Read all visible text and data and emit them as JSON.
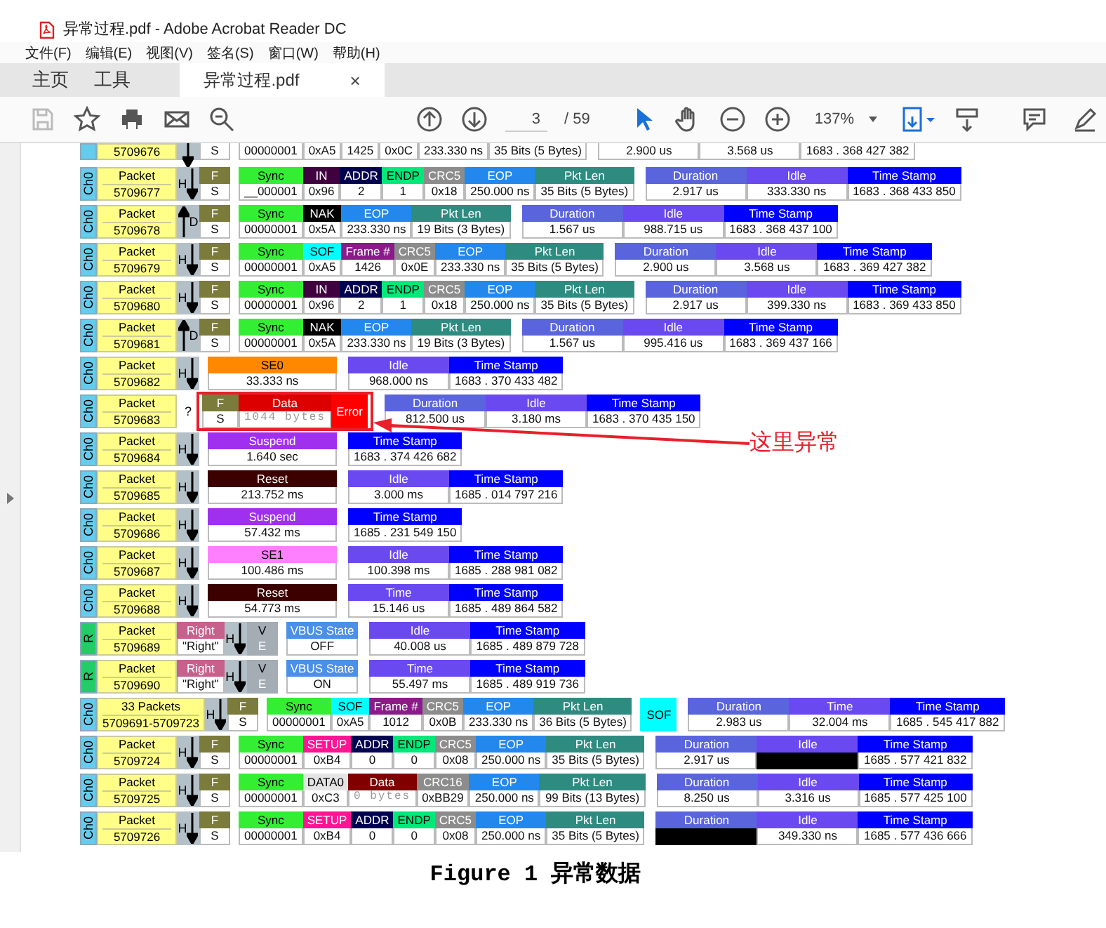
{
  "window": {
    "title": "异常过程.pdf - Adobe Acrobat Reader DC"
  },
  "menu": [
    "文件(F)",
    "编辑(E)",
    "视图(V)",
    "签名(S)",
    "窗口(W)",
    "帮助(H)"
  ],
  "tabs": [
    {
      "label": "主页",
      "selected": false,
      "kind": "nav"
    },
    {
      "label": "工具",
      "selected": false,
      "kind": "nav"
    },
    {
      "label": "异常过程.pdf",
      "selected": true,
      "kind": "document",
      "close": "×"
    }
  ],
  "toolbar": {
    "page": "3",
    "total": "/ 59",
    "zoom": "137%"
  },
  "rows": [
    {
      "kind": "partial",
      "channel": {
        "color": "#66ccee"
      },
      "packet": [
        "5709676"
      ],
      "flagged": false,
      "groups": [
        {
          "kind": "down"
        },
        {
          "kind": "attached",
          "fields": [
            {
              "value": "S"
            }
          ]
        },
        {
          "kind": "fields",
          "fields": [
            {
              "value": "00000001"
            },
            {
              "value": "0xA5"
            },
            {
              "value": "1425"
            },
            {
              "value": "0x0C"
            },
            {
              "value": "233.330 ns"
            },
            {
              "value": "35 Bits (5 Bytes)"
            }
          ]
        },
        {
          "kind": "timing",
          "fields": [
            {
              "value": "2.900 us"
            },
            {
              "value": "3.568 us"
            },
            {
              "value": "1683 . 368 427 382"
            }
          ]
        }
      ]
    },
    {
      "kind": "packet",
      "channel": {
        "label": "Ch0",
        "color": "#66ccee"
      },
      "packet": [
        "Packet",
        "5709677"
      ],
      "flagged": false,
      "groups": [
        {
          "kind": "down",
          "label": "H"
        },
        {
          "kind": "attached",
          "fields": [
            {
              "head": "F",
              "value": "S",
              "color": "#7b7b3b"
            }
          ]
        },
        {
          "kind": "fields",
          "fields": [
            {
              "head": "Sync",
              "value": "__000001",
              "color": "#33ee33"
            },
            {
              "head": "IN",
              "value": "0x96",
              "color": "#400040"
            },
            {
              "head": "ADDR",
              "value": "2",
              "color": "#000050"
            },
            {
              "head": "ENDP",
              "value": "1",
              "color": "#00e87a"
            },
            {
              "head": "CRC5",
              "value": "0x18",
              "color": "#8c8c8c"
            },
            {
              "head": "EOP",
              "value": "250.000 ns",
              "color": "#2288ee"
            },
            {
              "head": "Pkt Len",
              "value": "35 Bits (5 Bytes)",
              "color": "#2e8b80"
            }
          ]
        },
        {
          "kind": "timing",
          "fields": [
            {
              "head": "Duration",
              "value": "2.917 us",
              "color": "#5a64dc"
            },
            {
              "head": "Idle",
              "value": "333.330 ns",
              "color": "#6a4af0"
            },
            {
              "head": "Time Stamp",
              "value": "1683 . 368 433 850",
              "color": "#0000ff"
            }
          ]
        }
      ]
    },
    {
      "kind": "packet",
      "channel": {
        "label": "Ch0",
        "color": "#66ccee"
      },
      "packet": [
        "Packet",
        "5709678"
      ],
      "flagged": false,
      "groups": [
        {
          "kind": "up",
          "label": "D"
        },
        {
          "kind": "attached",
          "fields": [
            {
              "head": "F",
              "value": "S",
              "color": "#7b7b3b"
            }
          ]
        },
        {
          "kind": "fields",
          "fields": [
            {
              "head": "Sync",
              "value": "00000001",
              "color": "#33ee33"
            },
            {
              "head": "NAK",
              "value": "0x5A",
              "color": "#000000"
            },
            {
              "head": "EOP",
              "value": "233.330 ns",
              "color": "#2288ee"
            },
            {
              "head": "Pkt Len",
              "value": "19 Bits (3 Bytes)",
              "color": "#2e8b80"
            }
          ]
        },
        {
          "kind": "timing",
          "fields": [
            {
              "head": "Duration",
              "value": "1.567 us",
              "color": "#5a64dc"
            },
            {
              "head": "Idle",
              "value": "988.715 us",
              "color": "#6a4af0"
            },
            {
              "head": "Time Stamp",
              "value": "1683 . 368 437 100",
              "color": "#0000ff"
            }
          ]
        }
      ]
    },
    {
      "kind": "packet",
      "channel": {
        "label": "Ch0",
        "color": "#66ccee"
      },
      "packet": [
        "Packet",
        "5709679"
      ],
      "flagged": false,
      "groups": [
        {
          "kind": "down",
          "label": "H"
        },
        {
          "kind": "attached",
          "fields": [
            {
              "head": "F",
              "value": "S",
              "color": "#7b7b3b"
            }
          ]
        },
        {
          "kind": "fields",
          "fields": [
            {
              "head": "Sync",
              "value": "00000001",
              "color": "#33ee33"
            },
            {
              "head": "SOF",
              "value": "0xA5",
              "color": "#00ffff"
            },
            {
              "head": "Frame #",
              "value": "1426",
              "color": "#8b1a8b"
            },
            {
              "head": "CRC5",
              "value": "0x0E",
              "color": "#8c8c8c"
            },
            {
              "head": "EOP",
              "value": "233.330 ns",
              "color": "#2288ee"
            },
            {
              "head": "Pkt Len",
              "value": "35 Bits (5 Bytes)",
              "color": "#2e8b80"
            }
          ]
        },
        {
          "kind": "timing",
          "fields": [
            {
              "head": "Duration",
              "value": "2.900 us",
              "color": "#5a64dc"
            },
            {
              "head": "Idle",
              "value": "3.568 us",
              "color": "#6a4af0"
            },
            {
              "head": "Time Stamp",
              "value": "1683 . 369 427 382",
              "color": "#0000ff"
            }
          ]
        }
      ]
    },
    {
      "kind": "packet",
      "channel": {
        "label": "Ch0",
        "color": "#66ccee"
      },
      "packet": [
        "Packet",
        "5709680"
      ],
      "flagged": false,
      "groups": [
        {
          "kind": "down",
          "label": "H"
        },
        {
          "kind": "attached",
          "fields": [
            {
              "head": "F",
              "value": "S",
              "color": "#7b7b3b"
            }
          ]
        },
        {
          "kind": "fields",
          "fields": [
            {
              "head": "Sync",
              "value": "00000001",
              "color": "#33ee33"
            },
            {
              "head": "IN",
              "value": "0x96",
              "color": "#400040"
            },
            {
              "head": "ADDR",
              "value": "2",
              "color": "#000050"
            },
            {
              "head": "ENDP",
              "value": "1",
              "color": "#00e87a"
            },
            {
              "head": "CRC5",
              "value": "0x18",
              "color": "#8c8c8c"
            },
            {
              "head": "EOP",
              "value": "250.000 ns",
              "color": "#2288ee"
            },
            {
              "head": "Pkt Len",
              "value": "35 Bits (5 Bytes)",
              "color": "#2e8b80"
            }
          ]
        },
        {
          "kind": "timing",
          "fields": [
            {
              "head": "Duration",
              "value": "2.917 us",
              "color": "#5a64dc"
            },
            {
              "head": "Idle",
              "value": "399.330 ns",
              "color": "#6a4af0"
            },
            {
              "head": "Time Stamp",
              "value": "1683 . 369 433 850",
              "color": "#0000ff"
            }
          ]
        }
      ]
    },
    {
      "kind": "packet",
      "channel": {
        "label": "Ch0",
        "color": "#66ccee"
      },
      "packet": [
        "Packet",
        "5709681"
      ],
      "flagged": false,
      "groups": [
        {
          "kind": "up",
          "label": "D"
        },
        {
          "kind": "attached",
          "fields": [
            {
              "head": "F",
              "value": "S",
              "color": "#7b7b3b"
            }
          ]
        },
        {
          "kind": "fields",
          "fields": [
            {
              "head": "Sync",
              "value": "00000001",
              "color": "#33ee33"
            },
            {
              "head": "NAK",
              "value": "0x5A",
              "color": "#000000"
            },
            {
              "head": "EOP",
              "value": "233.330 ns",
              "color": "#2288ee"
            },
            {
              "head": "Pkt Len",
              "value": "19 Bits (3 Bytes)",
              "color": "#2e8b80"
            }
          ]
        },
        {
          "kind": "timing",
          "fields": [
            {
              "head": "Duration",
              "value": "1.567 us",
              "color": "#5a64dc"
            },
            {
              "head": "Idle",
              "value": "995.416 us",
              "color": "#6a4af0"
            },
            {
              "head": "Time Stamp",
              "value": "1683 . 369 437 166",
              "color": "#0000ff"
            }
          ]
        }
      ]
    },
    {
      "kind": "packet",
      "channel": {
        "label": "Ch0",
        "color": "#66ccee"
      },
      "packet": [
        "Packet",
        "5709682"
      ],
      "flagged": false,
      "groups": [
        {
          "kind": "down",
          "label": "H"
        },
        {
          "kind": "event",
          "fields": [
            {
              "head": "SE0",
              "value": "33.333 ns",
              "color": "#ff8800"
            }
          ]
        },
        {
          "kind": "timing",
          "fields": [
            {
              "head": "Idle",
              "value": "968.000 ns",
              "color": "#6a4af0"
            },
            {
              "head": "Time Stamp",
              "value": "1683 . 370 433 482",
              "color": "#0000ff"
            }
          ]
        }
      ]
    },
    {
      "kind": "packet",
      "channel": {
        "label": "Ch0",
        "color": "#66ccee"
      },
      "packet": [
        "Packet",
        "5709683"
      ],
      "flagged": true,
      "groups": [
        {
          "kind": "unknown",
          "label": "?"
        },
        {
          "kind": "fields",
          "fields": [
            {
              "head": "F",
              "value": "S",
              "color": "#7b7b3b"
            },
            {
              "head": "Data",
              "value": "1044 bytes",
              "color": "#dd0000",
              "kind": "mono"
            },
            {
              "head": "Error",
              "color": "#ff0000"
            }
          ]
        },
        {
          "kind": "timing",
          "fields": [
            {
              "head": "Duration",
              "value": "812.500 us",
              "color": "#5a64dc"
            },
            {
              "head": "Idle",
              "value": "3.180 ms",
              "color": "#6a4af0"
            },
            {
              "head": "Time Stamp",
              "value": "1683 . 370 435 150",
              "color": "#0000ff"
            }
          ]
        }
      ]
    },
    {
      "kind": "packet",
      "channel": {
        "label": "Ch0",
        "color": "#66ccee"
      },
      "packet": [
        "Packet",
        "5709684"
      ],
      "flagged": false,
      "groups": [
        {
          "kind": "down",
          "label": "H"
        },
        {
          "kind": "event",
          "fields": [
            {
              "head": "Suspend",
              "value": "1.640 sec",
              "color": "#a030f0"
            }
          ]
        },
        {
          "kind": "timing",
          "fields": [
            {
              "head": "Time Stamp",
              "value": "1683 . 374 426 682",
              "color": "#0000ff"
            }
          ]
        }
      ]
    },
    {
      "kind": "packet",
      "channel": {
        "label": "Ch0",
        "color": "#66ccee"
      },
      "packet": [
        "Packet",
        "5709685"
      ],
      "flagged": false,
      "groups": [
        {
          "kind": "down",
          "label": "H"
        },
        {
          "kind": "event",
          "fields": [
            {
              "head": "Reset",
              "value": "213.752 ms",
              "color": "#3c0000"
            }
          ]
        },
        {
          "kind": "timing",
          "fields": [
            {
              "head": "Idle",
              "value": "3.000 ms",
              "color": "#6a4af0"
            },
            {
              "head": "Time Stamp",
              "value": "1685 . 014 797 216",
              "color": "#0000ff"
            }
          ]
        }
      ]
    },
    {
      "kind": "packet",
      "channel": {
        "label": "Ch0",
        "color": "#66ccee"
      },
      "packet": [
        "Packet",
        "5709686"
      ],
      "flagged": false,
      "groups": [
        {
          "kind": "down",
          "label": "H"
        },
        {
          "kind": "event",
          "fields": [
            {
              "head": "Suspend",
              "value": "57.432 ms",
              "color": "#a030f0"
            }
          ]
        },
        {
          "kind": "timing",
          "fields": [
            {
              "head": "Time Stamp",
              "value": "1685 . 231 549 150",
              "color": "#0000ff"
            }
          ]
        }
      ]
    },
    {
      "kind": "packet",
      "channel": {
        "label": "Ch0",
        "color": "#66ccee"
      },
      "packet": [
        "Packet",
        "5709687"
      ],
      "flagged": false,
      "groups": [
        {
          "kind": "down",
          "label": "H"
        },
        {
          "kind": "event",
          "fields": [
            {
              "head": "SE1",
              "value": "100.486 ms",
              "color": "#ff80ff"
            }
          ]
        },
        {
          "kind": "timing",
          "fields": [
            {
              "head": "Idle",
              "value": "100.398 ms",
              "color": "#6a4af0"
            },
            {
              "head": "Time Stamp",
              "value": "1685 . 288 981 082",
              "color": "#0000ff"
            }
          ]
        }
      ]
    },
    {
      "kind": "packet",
      "channel": {
        "label": "Ch0",
        "color": "#66ccee"
      },
      "packet": [
        "Packet",
        "5709688"
      ],
      "flagged": false,
      "groups": [
        {
          "kind": "down",
          "label": "H"
        },
        {
          "kind": "event",
          "fields": [
            {
              "head": "Reset",
              "value": "54.773 ms",
              "color": "#3c0000"
            }
          ]
        },
        {
          "kind": "timing",
          "fields": [
            {
              "head": "Time",
              "value": "15.146 us",
              "color": "#6a4af0"
            },
            {
              "head": "Time Stamp",
              "value": "1685 . 489 864 582",
              "color": "#0000ff"
            }
          ]
        }
      ]
    },
    {
      "kind": "packet",
      "channel": {
        "label": "R",
        "color": "#22cc66"
      },
      "packet": [
        "Packet",
        "5709689"
      ],
      "flagged": false,
      "groups": [
        {
          "kind": "attached",
          "fields": [
            {
              "head": "Right",
              "value": "\"Right\"",
              "color": "#c8608c"
            }
          ]
        },
        {
          "kind": "down",
          "label": "H"
        },
        {
          "kind": "attached",
          "fields": [
            {
              "head": "V",
              "value": "E",
              "color": "#a4acb4",
              "kind": "shaded"
            }
          ]
        },
        {
          "kind": "fields",
          "fields": [
            {
              "head": "VBUS State",
              "value": "OFF",
              "color": "#4a90e8"
            }
          ]
        },
        {
          "kind": "timing",
          "fields": [
            {
              "head": "Idle",
              "value": "40.008 us",
              "color": "#6a4af0"
            },
            {
              "head": "Time Stamp",
              "value": "1685 . 489 879 728",
              "color": "#0000ff"
            }
          ]
        }
      ]
    },
    {
      "kind": "packet",
      "channel": {
        "label": "R",
        "color": "#22cc66"
      },
      "packet": [
        "Packet",
        "5709690"
      ],
      "flagged": false,
      "groups": [
        {
          "kind": "attached",
          "fields": [
            {
              "head": "Right",
              "value": "\"Right\"",
              "color": "#c8608c"
            }
          ]
        },
        {
          "kind": "down",
          "label": "H"
        },
        {
          "kind": "attached",
          "fields": [
            {
              "head": "V",
              "value": "E",
              "color": "#a4acb4",
              "kind": "shaded"
            }
          ]
        },
        {
          "kind": "fields",
          "fields": [
            {
              "head": "VBUS State",
              "value": "ON",
              "color": "#4a90e8"
            }
          ]
        },
        {
          "kind": "timing",
          "fields": [
            {
              "head": "Time",
              "value": "55.497 ms",
              "color": "#6a4af0"
            },
            {
              "head": "Time Stamp",
              "value": "1685 . 489 919 736",
              "color": "#0000ff"
            }
          ]
        }
      ]
    },
    {
      "kind": "packet",
      "channel": {
        "label": "Ch0",
        "color": "#66ccee"
      },
      "packet": [
        "33 Packets",
        "5709691-5709723"
      ],
      "flagged": false,
      "groups": [
        {
          "kind": "down",
          "label": "H"
        },
        {
          "kind": "attached",
          "fields": [
            {
              "head": "F",
              "value": "S",
              "color": "#7b7b3b"
            }
          ]
        },
        {
          "kind": "fields",
          "fields": [
            {
              "head": "Sync",
              "value": "00000001",
              "color": "#33ee33"
            },
            {
              "head": "SOF",
              "value": "0xA5",
              "color": "#00ffff"
            },
            {
              "head": "Frame #",
              "value": "1012",
              "color": "#8b1a8b"
            },
            {
              "head": "CRC5",
              "value": "0x0B",
              "color": "#8c8c8c"
            },
            {
              "head": "EOP",
              "value": "233.330 ns",
              "color": "#2288ee"
            },
            {
              "head": "Pkt Len",
              "value": "36 Bits (5 Bytes)",
              "color": "#2e8b80"
            }
          ]
        },
        {
          "kind": "fields",
          "fields": [
            {
              "head": "SOF",
              "color": "#00ffff"
            }
          ]
        },
        {
          "kind": "timing",
          "fields": [
            {
              "head": "Duration",
              "value": "2.983 us",
              "color": "#5a64dc"
            },
            {
              "head": "Time",
              "value": "32.004 ms",
              "color": "#6a4af0"
            },
            {
              "head": "Time Stamp",
              "value": "1685 . 545 417 882",
              "color": "#0000ff"
            }
          ]
        }
      ]
    },
    {
      "kind": "packet",
      "channel": {
        "label": "Ch0",
        "color": "#66ccee"
      },
      "packet": [
        "Packet",
        "5709724"
      ],
      "flagged": false,
      "groups": [
        {
          "kind": "down",
          "label": "H"
        },
        {
          "kind": "attached",
          "fields": [
            {
              "head": "F",
              "value": "S",
              "color": "#7b7b3b"
            }
          ]
        },
        {
          "kind": "fields",
          "fields": [
            {
              "head": "Sync",
              "value": "00000001",
              "color": "#33ee33"
            },
            {
              "head": "SETUP",
              "value": "0xB4",
              "color": "#ff1493"
            },
            {
              "head": "ADDR",
              "value": "0",
              "color": "#000050"
            },
            {
              "head": "ENDP",
              "value": "0",
              "color": "#00e87a"
            },
            {
              "head": "CRC5",
              "value": "0x08",
              "color": "#8c8c8c"
            },
            {
              "head": "EOP",
              "value": "250.000 ns",
              "color": "#2288ee"
            },
            {
              "head": "Pkt Len",
              "value": "35 Bits (5 Bytes)",
              "color": "#2e8b80"
            }
          ]
        },
        {
          "kind": "timing",
          "fields": [
            {
              "head": "Duration",
              "value": "2.917 us",
              "color": "#5a64dc"
            },
            {
              "head": "Idle",
              "color": "#6a4af0",
              "kind": "masked"
            },
            {
              "head": "Time Stamp",
              "value": "1685 . 577 421 832",
              "color": "#0000ff"
            }
          ]
        }
      ]
    },
    {
      "kind": "packet",
      "channel": {
        "label": "Ch0",
        "color": "#66ccee"
      },
      "packet": [
        "Packet",
        "5709725"
      ],
      "flagged": false,
      "groups": [
        {
          "kind": "down",
          "label": "H"
        },
        {
          "kind": "attached",
          "fields": [
            {
              "head": "F",
              "value": "S",
              "color": "#7b7b3b"
            }
          ]
        },
        {
          "kind": "fields",
          "fields": [
            {
              "head": "Sync",
              "value": "00000001",
              "color": "#33ee33"
            },
            {
              "head": "DATA0",
              "value": "0xC3",
              "color": "#e4e4e4"
            },
            {
              "head": "Data",
              "value": "0 bytes",
              "color": "#800000",
              "kind": "mono"
            },
            {
              "head": "CRC16",
              "value": "0xBB29",
              "color": "#8c8c8c"
            },
            {
              "head": "EOP",
              "value": "250.000 ns",
              "color": "#2288ee"
            },
            {
              "head": "Pkt Len",
              "value": "99 Bits (13 Bytes)",
              "color": "#2e8b80"
            }
          ]
        },
        {
          "kind": "timing",
          "fields": [
            {
              "head": "Duration",
              "value": "8.250 us",
              "color": "#5a64dc"
            },
            {
              "head": "Idle",
              "value": "3.316 us",
              "color": "#6a4af0"
            },
            {
              "head": "Time Stamp",
              "value": "1685 . 577 425 100",
              "color": "#0000ff"
            }
          ]
        }
      ]
    },
    {
      "kind": "packet",
      "channel": {
        "label": "Ch0",
        "color": "#66ccee"
      },
      "packet": [
        "Packet",
        "5709726"
      ],
      "flagged": false,
      "groups": [
        {
          "kind": "down",
          "label": "H"
        },
        {
          "kind": "attached",
          "fields": [
            {
              "head": "F",
              "value": "S",
              "color": "#7b7b3b"
            }
          ]
        },
        {
          "kind": "fields",
          "fields": [
            {
              "head": "Sync",
              "value": "00000001",
              "color": "#33ee33"
            },
            {
              "head": "SETUP",
              "value": "0xB4",
              "color": "#ff1493"
            },
            {
              "head": "ADDR",
              "value": "0",
              "color": "#000050"
            },
            {
              "head": "ENDP",
              "value": "0",
              "color": "#00e87a"
            },
            {
              "head": "CRC5",
              "value": "0x08",
              "color": "#8c8c8c"
            },
            {
              "head": "EOP",
              "value": "250.000 ns",
              "color": "#2288ee"
            },
            {
              "head": "Pkt Len",
              "value": "35 Bits (5 Bytes)",
              "color": "#2e8b80"
            }
          ]
        },
        {
          "kind": "timing",
          "fields": [
            {
              "head": "Duration",
              "color": "#5a64dc",
              "kind": "masked"
            },
            {
              "head": "Idle",
              "value": "349.330 ns",
              "color": "#6a4af0"
            },
            {
              "head": "Time Stamp",
              "value": "1685 . 577 436 666",
              "color": "#0000ff"
            }
          ]
        }
      ]
    }
  ],
  "annotation": {
    "text": "这里异常"
  },
  "caption": "Figure 1 异常数据"
}
